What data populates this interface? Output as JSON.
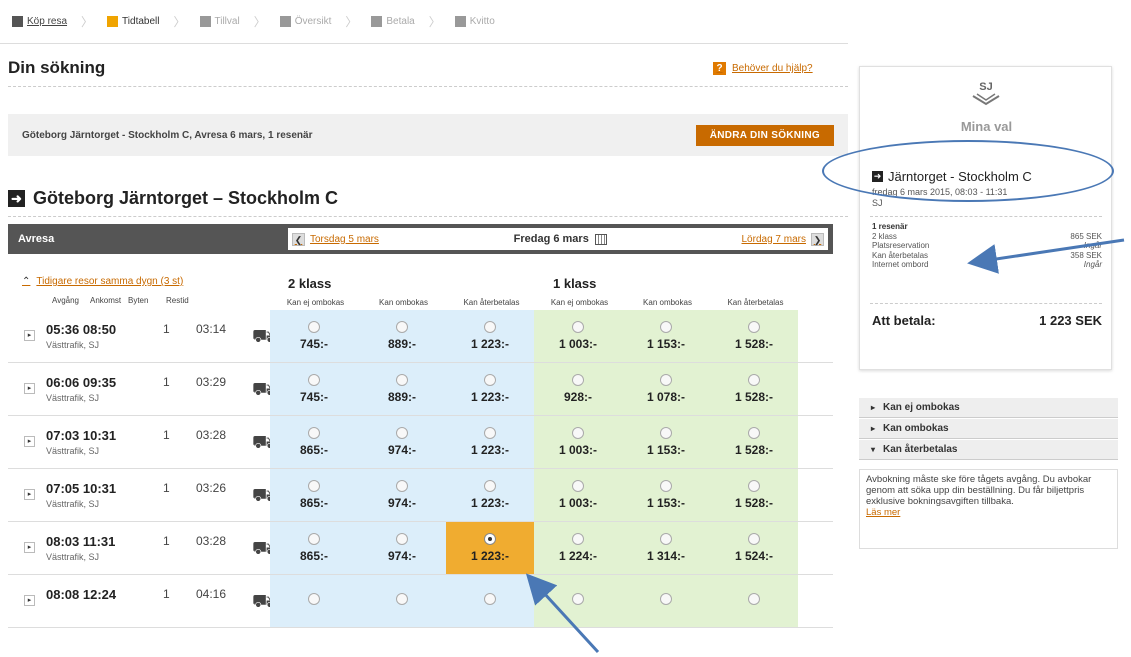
{
  "steps": [
    {
      "label": "Köp resa",
      "state": "done"
    },
    {
      "label": "Tidtabell",
      "state": "current"
    },
    {
      "label": "Tillval",
      "state": "todo"
    },
    {
      "label": "Översikt",
      "state": "todo"
    },
    {
      "label": "Betala",
      "state": "todo"
    },
    {
      "label": "Kvitto",
      "state": "todo"
    }
  ],
  "search": {
    "title": "Din sökning",
    "help_label": "Behöver du hjälp?",
    "help_icon": "?",
    "summary": "Göteborg Järntorget - Stockholm C, Avresa 6 mars, 1 resenär",
    "change_button": "ÄNDRA DIN SÖKNING"
  },
  "route": {
    "title": "Göteborg Järntorget – Stockholm C",
    "icon": "arrow-right-icon"
  },
  "datebar": {
    "label": "Avresa",
    "prev": "Torsdag 5 mars",
    "current": "Fredag 6 mars",
    "next": "Lördag 7 mars"
  },
  "table": {
    "earlier_link": "Tidigare resor samma dygn (3 st)",
    "cols": {
      "dep": "Avgång",
      "arr": "Ankomst",
      "chg": "Byten",
      "dur": "Restid"
    },
    "class2": "2 klass",
    "class1": "1 klass",
    "fares": [
      "Kan ej ombokas",
      "Kan ombokas",
      "Kan återbetalas",
      "Kan ej ombokas",
      "Kan ombokas",
      "Kan återbetalas"
    ],
    "rows": [
      {
        "time": "05:36  08:50",
        "op": "Västtrafik, SJ",
        "chg": "1",
        "dur": "03:14",
        "prices": [
          "745:-",
          "889:-",
          "1 223:-",
          "1 003:-",
          "1 153:-",
          "1 528:-"
        ]
      },
      {
        "time": "06:06  09:35",
        "op": "Västtrafik, SJ",
        "chg": "1",
        "dur": "03:29",
        "prices": [
          "745:-",
          "889:-",
          "1 223:-",
          "928:-",
          "1 078:-",
          "1 528:-"
        ]
      },
      {
        "time": "07:03  10:31",
        "op": "Västtrafik, SJ",
        "chg": "1",
        "dur": "03:28",
        "prices": [
          "865:-",
          "974:-",
          "1 223:-",
          "1 003:-",
          "1 153:-",
          "1 528:-"
        ]
      },
      {
        "time": "07:05  10:31",
        "op": "Västtrafik, SJ",
        "chg": "1",
        "dur": "03:26",
        "prices": [
          "865:-",
          "974:-",
          "1 223:-",
          "1 003:-",
          "1 153:-",
          "1 528:-"
        ]
      },
      {
        "time": "08:03  11:31",
        "op": "Västtrafik, SJ",
        "chg": "1",
        "dur": "03:28",
        "prices": [
          "865:-",
          "974:-",
          "1 223:-",
          "1 224:-",
          "1 314:-",
          "1 524:-"
        ],
        "selected": 2
      },
      {
        "time": "08:08  12:24",
        "op": "",
        "chg": "1",
        "dur": "04:16",
        "prices": [
          "",
          "",
          "",
          "",
          "",
          ""
        ]
      }
    ]
  },
  "panel": {
    "logo": "SJ",
    "title": "Mina val",
    "route": "Järntorget - Stockholm C",
    "date": "fredag 6 mars 2015, 08:03 - 11:31",
    "operator": "SJ",
    "items_head": "1 resenär",
    "items": [
      {
        "label": "2 klass",
        "value": "865 SEK"
      },
      {
        "label": "Platsreservation",
        "value": "Ingår"
      },
      {
        "label": "Kan återbetalas",
        "value": "358 SEK"
      },
      {
        "label": "Internet ombord",
        "value": "Ingår"
      }
    ],
    "pay_label": "Att betala:",
    "pay_value": "1 223 SEK"
  },
  "accordion": [
    {
      "label": "Kan ej ombokas",
      "open": false
    },
    {
      "label": "Kan ombokas",
      "open": false
    },
    {
      "label": "Kan återbetalas",
      "open": true
    }
  ],
  "accordion_body": {
    "text": "Avbokning måste ske före tågets avgång. Du avbokar genom att söka upp din beställning. Du får biljettpris exklusive bokningsavgiften tillbaka.",
    "more": "Läs mer"
  },
  "colors": {
    "accent": "#c86a00",
    "class2_bg": "#dceefa",
    "class1_bg": "#e2f2d2",
    "selected_bg": "#f0ac30",
    "annotation": "#4a78b5"
  }
}
